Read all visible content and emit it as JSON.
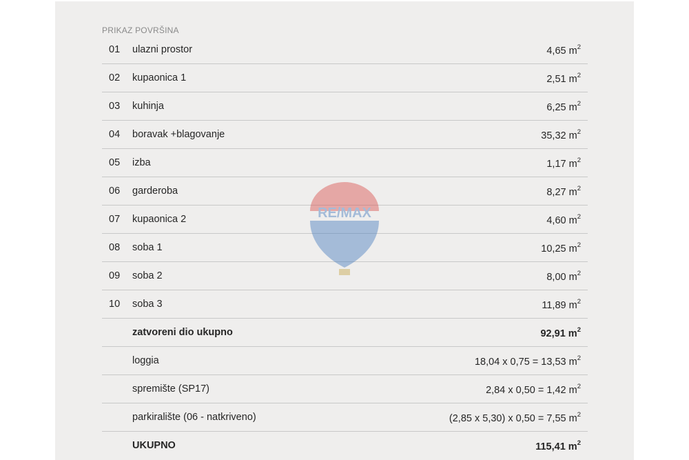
{
  "caption": "PRIKAZ POVRŠINA",
  "unit_exp": "2",
  "watermark": {
    "brand": "RE/MAX",
    "colors": {
      "red": "#d9534f",
      "blue": "#4a7fbf"
    }
  },
  "rows": [
    {
      "num": "01",
      "name": "ulazni prostor",
      "value": "4,65 m"
    },
    {
      "num": "02",
      "name": "kupaonica 1",
      "value": "2,51 m"
    },
    {
      "num": "03",
      "name": "kuhinja",
      "value": "6,25 m"
    },
    {
      "num": "04",
      "name": "boravak +blagovanje",
      "value": "35,32 m"
    },
    {
      "num": "05",
      "name": "izba",
      "value": "1,17 m"
    },
    {
      "num": "06",
      "name": "garderoba",
      "value": "8,27 m"
    },
    {
      "num": "07",
      "name": "kupaonica 2",
      "value": "4,60 m"
    },
    {
      "num": "08",
      "name": "soba 1",
      "value": "10,25 m"
    },
    {
      "num": "09",
      "name": "soba 2",
      "value": "8,00 m"
    },
    {
      "num": "10",
      "name": "soba 3",
      "value": "11,89 m"
    },
    {
      "num": "",
      "name": "zatvoreni dio ukupno",
      "value": "92,91 m"
    },
    {
      "num": "",
      "name": "loggia",
      "value": "18,04 x 0,75 = 13,53 m"
    },
    {
      "num": "",
      "name": "spremište (SP17)",
      "value": "2,84 x 0,50 = 1,42 m"
    },
    {
      "num": "",
      "name": "parkiralište (06 - natkriveno)",
      "value": "(2,85 x 5,30) x 0,50 = 7,55 m"
    },
    {
      "num": "",
      "name": "UKUPNO",
      "value": "115,41 m"
    }
  ]
}
